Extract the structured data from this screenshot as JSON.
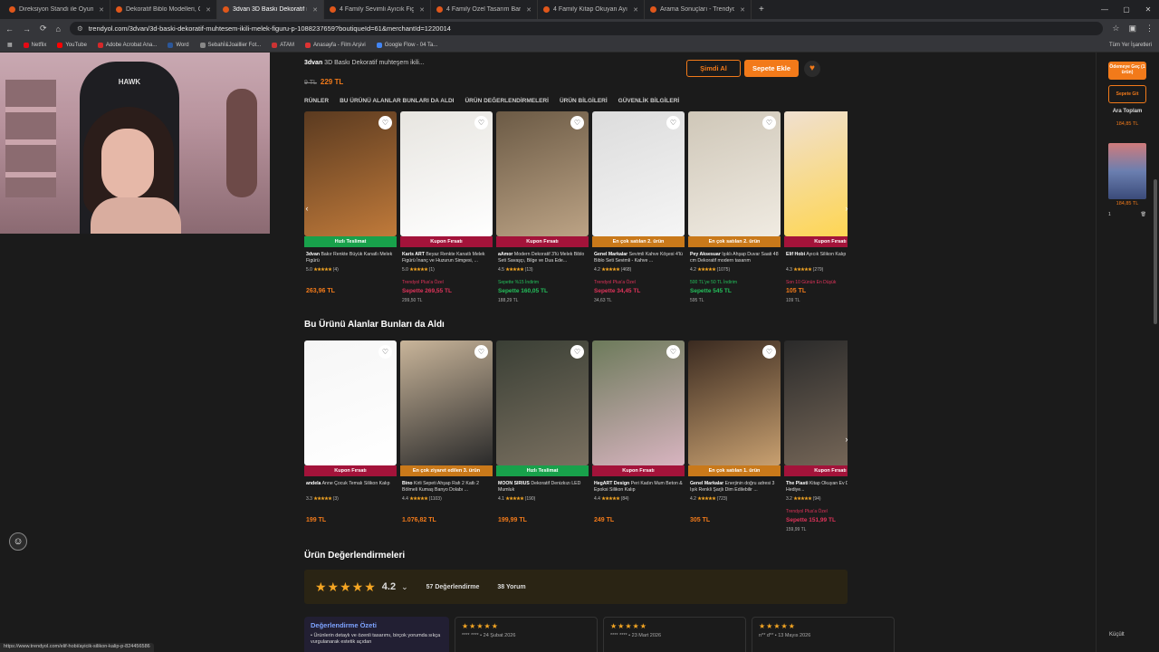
{
  "browser": {
    "tabs": [
      {
        "label": "Direksiyon Standı ile Oyun"
      },
      {
        "label": "Dekoratif Biblo Modelleri, Ofis"
      },
      {
        "label": "3dvan 3D Baskı Dekoratif muh"
      },
      {
        "label": "4 Family Sevimli Ayıcık Figürü"
      },
      {
        "label": "4 Family Özel Tasarım Barista A"
      },
      {
        "label": "4 Family Kitap Okuyan Ayıcık B"
      },
      {
        "label": "Arama Sonuçları - Trendyol"
      }
    ],
    "url": "trendyol.com/3dvan/3d-baski-dekoratif-muhtesem-ikili-melek-figuru-p-1088237659?boutiqueId=61&merchantId=1220014",
    "bookmarks": [
      "Netflix",
      "YouTube",
      "Adobe Acrobat Ana...",
      "Word",
      "Sebahİ&Joaillier Fot...",
      "ATAM",
      "Anasayfa - Film Arşivi",
      "Google Flow - 04 Ta..."
    ],
    "all_bookmarks": "Tüm Yer İşaretleri",
    "status_url": "https://www.trendyol.com/elif-hobi/ayicik-silikon-kalip-p-824456586"
  },
  "webcam": {
    "logo": "HAWK"
  },
  "sticky": {
    "title_brand": "3dvan",
    "title_rest": " 3D Baskı Dekoratif muhteşem ikili...",
    "old_price": "9 TL",
    "price": "229 TL",
    "buy_now": "Şimdi Al",
    "add_cart": "Sepete Ekle"
  },
  "subtabs": [
    "RÜNLER",
    "BU ÜRÜNÜ ALANLAR BUNLARI DA ALDI",
    "ÜRÜN DEĞERLENDİRMELERİ",
    "ÜRÜN BİLGİLERİ",
    "GÜVENLİK BİLGİLERİ"
  ],
  "row1": [
    {
      "badge": "Hızlı Teslimat",
      "badge_color": "#18a14b",
      "brand": "3dvan",
      "name": "Bakır Renkte Büyük Kanatlı Melek Figürü",
      "rating": "5.0",
      "stars": "★★★★★",
      "count": "(4)",
      "promo": "",
      "price": "263,96 TL",
      "old": ""
    },
    {
      "badge": "Kupon Fırsatı",
      "badge_color": "#a3133a",
      "brand": "Karis ART",
      "name": "Beyaz Renkte Kanatlı Melek Figürü İnanç ve Huzurun Simgesi, ...",
      "rating": "5.0",
      "stars": "★★★★★",
      "count": "(1)",
      "promo": "Trendyol Plus'a Özel",
      "price": "Sepette 269,55 TL",
      "old": "299,50 TL"
    },
    {
      "badge": "Kupon Fırsatı",
      "badge_color": "#a3133a",
      "brand": "aAmor",
      "name": "Modern Dekoratif 3'lü Melek Biblo Seti Savaşçı, Bilge ve Dua Ede...",
      "rating": "4.5",
      "stars": "★★★★★",
      "count": "(13)",
      "promo": "Sepette %15 İndirim",
      "price": "Sepette 160,05 TL",
      "old": "188,29 TL"
    },
    {
      "badge": "En çok satılan 2. ürün",
      "badge_color": "#c9791a",
      "brand": "Genel Markalar",
      "name": "Sevimli Kahve Köşesi 4'lü Biblo Seti Sevimli - Kahve ...",
      "rating": "4.2",
      "stars": "★★★★★",
      "count": "(468)",
      "promo": "Trendyol Plus'a Özel",
      "price": "Sepette 34,45 TL",
      "old": "34,63 TL"
    },
    {
      "badge": "En çok satılan 2. ürün",
      "badge_color": "#c9791a",
      "brand": "Pey Aksesuar",
      "name": "Işıklı Ahşap Duvar Saati 48 cm Dekoratif modern tasarım",
      "rating": "4.2",
      "stars": "★★★★★",
      "count": "(1075)",
      "promo": "500 TL'ye 50 TL İndirim",
      "price": "Sepette 545 TL",
      "old": "595 TL"
    },
    {
      "badge": "Kupon Fırsatı",
      "badge_color": "#a3133a",
      "brand": "Elif Hobi",
      "name": "Ayıcık Silikon Kalıp",
      "rating": "4.3",
      "stars": "★★★★★",
      "count": "(279)",
      "promo": "Son 10 Günün En Düşük",
      "price": "105 TL",
      "old": "109 TL"
    }
  ],
  "row2_title": "Bu Ürünü Alanlar Bunları da Aldı",
  "row2": [
    {
      "badge": "Kupon Fırsatı",
      "badge_color": "#a3133a",
      "brand": "andela",
      "name": "Anne Çocuk Temalı Silikon Kalıp",
      "rating": "3.3",
      "stars": "★★★★★",
      "count": "(3)",
      "promo": "",
      "price": "199 TL",
      "old": ""
    },
    {
      "badge": "En çok ziyaret edilen 3. ürün",
      "badge_color": "#c9791a",
      "brand": "Bino",
      "name": "Kirli Sepeti Ahşap Rafı 2 Katlı 2 Bölmeli Kumaş Banyo Dolabı ...",
      "rating": "4.4",
      "stars": "★★★★★",
      "count": "(1103)",
      "promo": "",
      "price": "1.076,82 TL",
      "old": ""
    },
    {
      "badge": "Hızlı Teslimat",
      "badge_color": "#18a14b",
      "brand": "MOON SIRIUS",
      "name": "Dekoratif Denizkızı LED Mumluk",
      "rating": "4.1",
      "stars": "★★★★★",
      "count": "(190)",
      "promo": "",
      "price": "199,99 TL",
      "old": ""
    },
    {
      "badge": "Kupon Fırsatı",
      "badge_color": "#a3133a",
      "brand": "HegART Design",
      "name": "Peri Kadın Mum Beton & Epoksi Silikon Kalıp",
      "rating": "4.4",
      "stars": "★★★★★",
      "count": "(84)",
      "promo": "",
      "price": "249 TL",
      "old": ""
    },
    {
      "badge": "En çok satılan 1. ürün",
      "badge_color": "#c9791a",
      "brand": "Genel Markalar",
      "name": "Enerjinin doğru adresi 3 Işık Renkli Şarjlı Dim Edilebilir ...",
      "rating": "4.2",
      "stars": "★★★★★",
      "count": "(723)",
      "promo": "",
      "price": "305 TL",
      "old": ""
    },
    {
      "badge": "Kupon Fırsatı",
      "badge_color": "#a3133a",
      "brand": "The Plasti",
      "name": "Kitap Okuyan Ev Dekorasyonu Hediye...",
      "rating": "3.2",
      "stars": "★★★★★",
      "count": "(94)",
      "promo": "Trendyol Plus'a Özel",
      "price": "Sepette 151,99 TL",
      "old": "159,99 TL"
    }
  ],
  "reviews": {
    "title": "Ürün Değerlendirmeleri",
    "stars": "★★★★★",
    "score": "4.2",
    "ratings": "57 Değerlendirme",
    "comments": "38 Yorum",
    "summary_title": "Değerlendirme Özeti",
    "summary_text": "• Ürünlerin detaylı ve özenli tasarımı, birçok yorumda sıkça vurgulanarak estetik açıdan",
    "cards": [
      {
        "stars": "★★★★★",
        "meta": "**** ****   •   24 Şubat 2026"
      },
      {
        "stars": "★★★★★",
        "meta": "**** ****   •   23 Mart 2026"
      },
      {
        "stars": "★★★★★",
        "meta": "n** d**   •   13 Mayıs 2026"
      }
    ]
  },
  "cart_panel": {
    "go_pay": "Ödemeye Geç (1 ürün)",
    "go_cart": "Sepete Git",
    "subtotal_label": "Ara Toplam",
    "subtotal": "184,85 TL",
    "item_price": "184,85 TL",
    "qty": "1",
    "shrink": "Küçült"
  }
}
